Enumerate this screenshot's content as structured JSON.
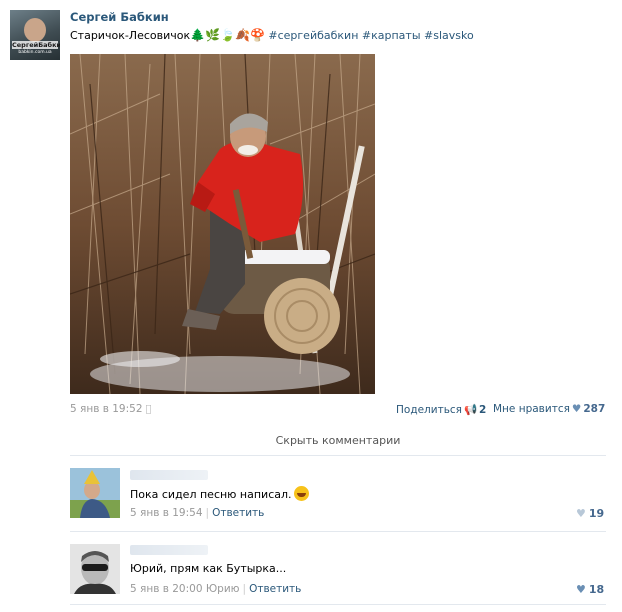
{
  "post": {
    "author": "Сергей Бабкин",
    "avatar_caption": "СергейБабкин",
    "avatar_caption_small": "babkin.com.ua",
    "text": "Старичок-Лесовичок",
    "emojis": [
      "🌲",
      "🌿",
      "🍃",
      "🍂",
      "🍄"
    ],
    "hashtags": [
      "#сергейбабкин",
      "#карпаты",
      "#slavsko"
    ],
    "date": "5 янв в 19:52",
    "share_label": "Поделиться",
    "share_count": "2",
    "like_label": "Мне нравится",
    "like_count": "287"
  },
  "comments_toggle": "Скрыть комментарии",
  "comments": [
    {
      "text": "Пока сидел песню написал.",
      "date": "5 янв в 19:54",
      "reply_label": "Ответить",
      "likes": "19"
    },
    {
      "text": "Юрий, прям как Бутырка...",
      "date": "5 янв в 20:00 Юрию",
      "reply_label": "Ответить",
      "likes": "18"
    }
  ],
  "icons": {
    "platform": "apple-icon",
    "share": "megaphone-icon",
    "like": "heart-icon"
  },
  "colors": {
    "link": "#2b587a",
    "meta": "#999999",
    "divider": "#e3e8ee"
  }
}
